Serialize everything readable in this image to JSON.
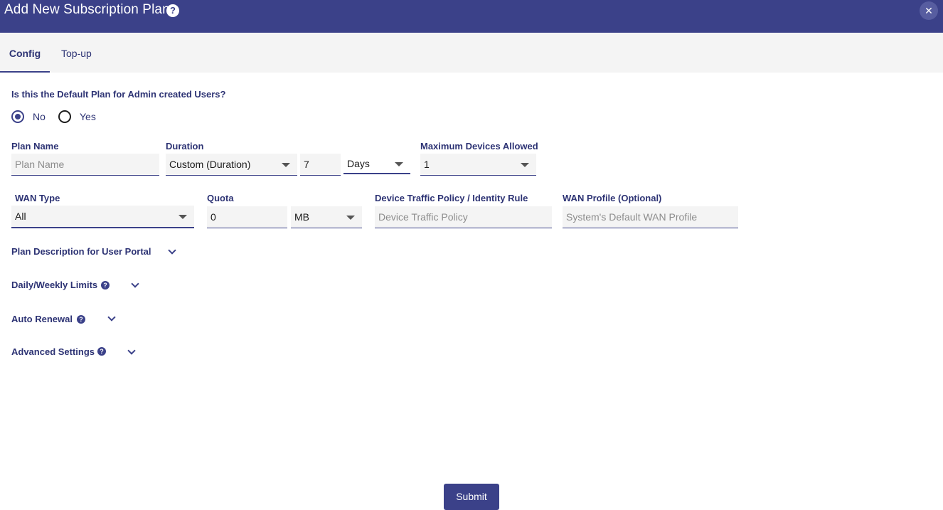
{
  "dialog": {
    "title": "Add New Subscription Plan",
    "help_icon": "question-circle-icon",
    "close_icon": "close-icon",
    "close_glyph": "✕"
  },
  "tabs": [
    {
      "label": "Config",
      "active": true
    },
    {
      "label": "Top-up",
      "active": false
    }
  ],
  "default_plan": {
    "question": "Is this the Default Plan for Admin created Users?",
    "options": [
      {
        "label": "No",
        "selected": true
      },
      {
        "label": "Yes",
        "selected": false
      }
    ]
  },
  "fields": {
    "plan_name": {
      "label": "Plan Name",
      "value": "",
      "placeholder": "Plan Name"
    },
    "duration": {
      "label": "Duration",
      "type_value": "Custom (Duration)",
      "amount": "7",
      "unit": "Days"
    },
    "max_devices": {
      "label": "Maximum Devices Allowed",
      "value": "1"
    },
    "wan_type": {
      "label": "WAN Type",
      "value": "All"
    },
    "quota": {
      "label": "Quota",
      "value": "0",
      "unit": "MB"
    },
    "device_traffic_policy": {
      "label": "Device Traffic Policy / Identity Rule",
      "value": "",
      "placeholder": "Device Traffic Policy"
    },
    "wan_profile": {
      "label": "WAN Profile (Optional)",
      "value": "",
      "placeholder": "System's Default WAN Profile"
    }
  },
  "sections": [
    {
      "label": "Plan Description for User Portal",
      "has_help": false
    },
    {
      "label": "Daily/Weekly Limits",
      "has_help": true
    },
    {
      "label": "Auto Renewal",
      "has_help": true
    },
    {
      "label": "Advanced Settings",
      "has_help": true
    }
  ],
  "help_glyph": "?",
  "submit_label": "Submit",
  "colors": {
    "primary": "#3b4189",
    "text": "#2d3374",
    "field_bg": "#f4f4f4",
    "placeholder": "#8c8c8c"
  }
}
